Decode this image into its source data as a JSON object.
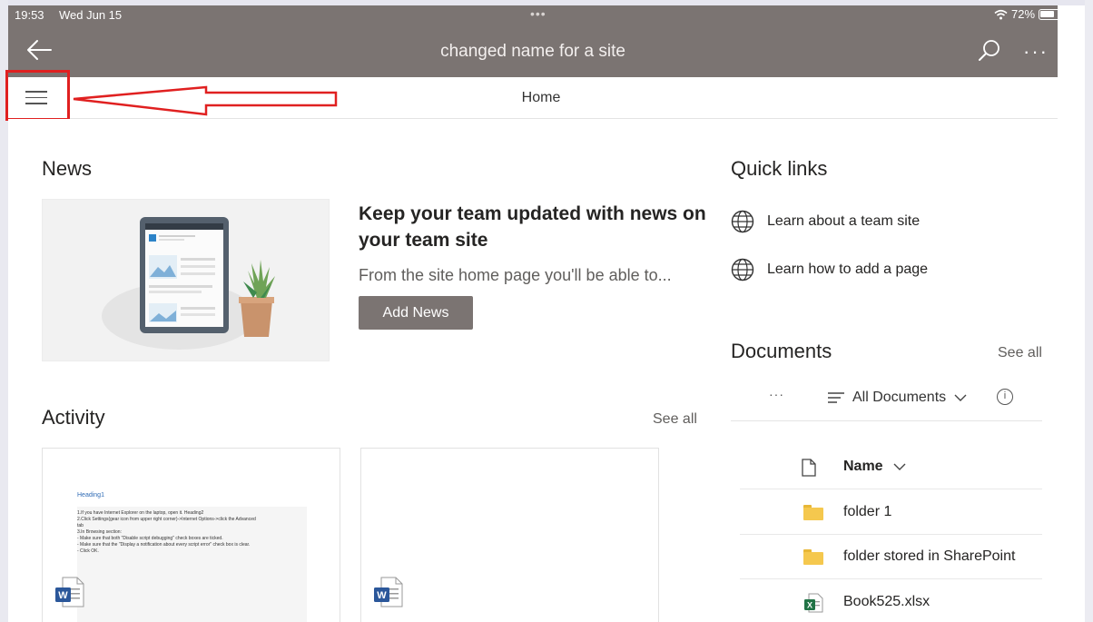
{
  "status_bar": {
    "time": "19:53",
    "date": "Wed Jun 15",
    "dots": "•••",
    "battery": "72%"
  },
  "header": {
    "title": "changed name for a site",
    "more_label": "···",
    "bar_color": "#7b7472"
  },
  "nav": {
    "home_label": "Home"
  },
  "annotation": {
    "color": "#e02020"
  },
  "news": {
    "heading": "News",
    "headline": "Keep your team updated with news on your team site",
    "description": "From the site home page you'll be able to...",
    "button_label": "Add News"
  },
  "activity": {
    "heading": "Activity",
    "see_all": "See all",
    "cards": [
      {
        "preview_heading": "Heading1",
        "preview_lines": [
          "1.If you have Internet Explorer on the laptop, open it. Heading2",
          "2.Click Settings(gear icon from upper right corner)->Internet Options->click the Advanced",
          "tab",
          "3.In Browsing section:",
          "- Make sure that both \"Disable script debugging\" check boxes are ticked.",
          "- Make sure that the \"Display a notification about every script error\" check box is clear.",
          "- Click OK."
        ],
        "file_type_icon": "word-icon"
      },
      {
        "preview_heading": "",
        "preview_lines": [],
        "file_type_icon": "word-icon"
      }
    ]
  },
  "quick_links": {
    "heading": "Quick links",
    "items": [
      {
        "label": "Learn about a team site",
        "icon": "globe-icon"
      },
      {
        "label": "Learn how to add a page",
        "icon": "globe-icon"
      }
    ]
  },
  "documents": {
    "heading": "Documents",
    "see_all": "See all",
    "toolbar": {
      "more_label": "···",
      "view_label": "All Documents",
      "info_label": "i"
    },
    "column_name": "Name",
    "rows": [
      {
        "name": "folder 1",
        "icon": "folder-icon"
      },
      {
        "name": "folder stored in SharePoint",
        "icon": "folder-icon"
      },
      {
        "name": "Book525.xlsx",
        "icon": "excel-icon"
      }
    ]
  }
}
